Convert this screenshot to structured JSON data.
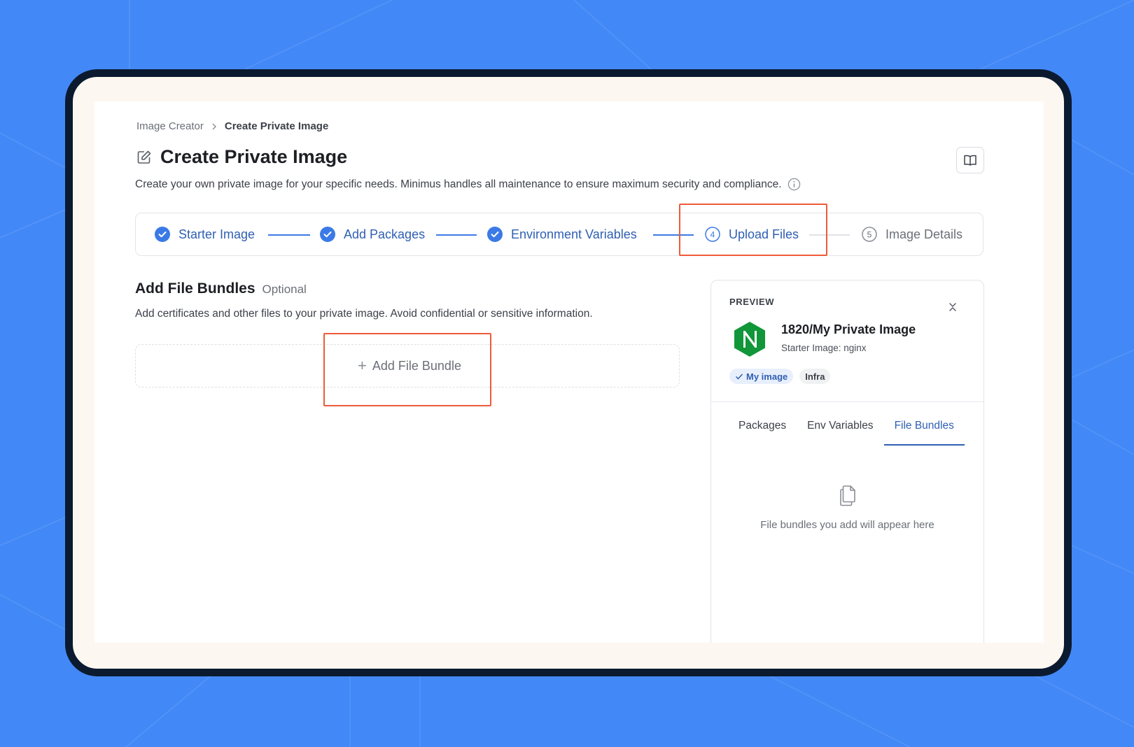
{
  "breadcrumb": {
    "parent": "Image Creator",
    "current": "Create Private Image"
  },
  "page": {
    "title": "Create Private Image",
    "subtitle": "Create your own private image for your specific needs. Minimus handles all maintenance to ensure maximum security and compliance."
  },
  "stepper": {
    "steps": [
      {
        "label": "Starter Image",
        "state": "complete"
      },
      {
        "label": "Add Packages",
        "state": "complete"
      },
      {
        "label": "Environment Variables",
        "state": "complete"
      },
      {
        "label": "Upload Files",
        "state": "current",
        "number": "4"
      },
      {
        "label": "Image Details",
        "state": "upcoming",
        "number": "5"
      }
    ]
  },
  "file_bundles": {
    "title": "Add File Bundles",
    "optional": "Optional",
    "description": "Add certificates and other files to your private image. Avoid confidential or sensitive information.",
    "add_button": "Add File Bundle"
  },
  "preview": {
    "label": "PREVIEW",
    "image_name": "1820/My Private Image",
    "starter": "Starter Image: nginx",
    "logo_letter": "N",
    "tags": [
      "My image",
      "Infra"
    ],
    "tabs": [
      "Packages",
      "Env Variables",
      "File Bundles"
    ],
    "active_tab": "File Bundles",
    "empty_message": "File bundles you add will appear here"
  },
  "colors": {
    "background": "#4388f7",
    "accent": "#2f5fb3",
    "highlight": "#ef5a3a",
    "nginx_green": "#119639"
  },
  "icons": [
    "chevron-right-icon",
    "edit-icon",
    "book-icon",
    "info-icon",
    "check-circle-icon",
    "collapse-icon",
    "nginx-logo",
    "plus-icon",
    "files-icon"
  ]
}
